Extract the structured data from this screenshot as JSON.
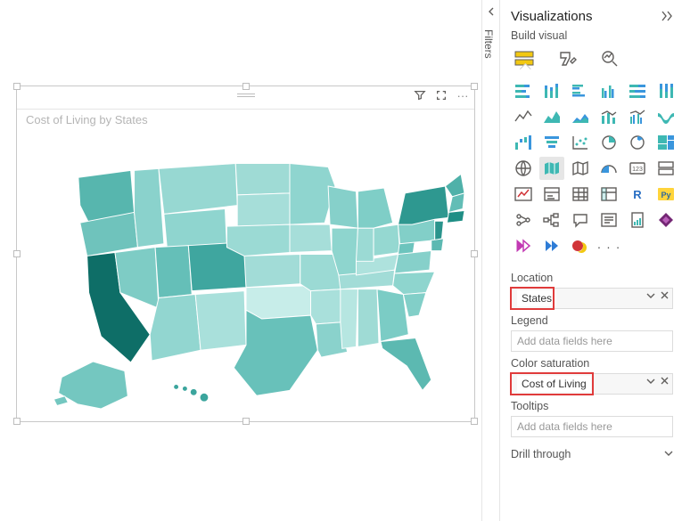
{
  "canvas": {
    "title": "Cost of Living by States"
  },
  "filters_rail": {
    "label": "Filters"
  },
  "panel": {
    "title": "Visualizations",
    "subtitle": "Build visual",
    "fields": {
      "location": {
        "label": "Location",
        "value": "States"
      },
      "legend": {
        "label": "Legend",
        "placeholder": "Add data fields here"
      },
      "saturation": {
        "label": "Color saturation",
        "value": "Cost of Living"
      },
      "tooltips": {
        "label": "Tooltips",
        "placeholder": "Add data fields here"
      },
      "drill": {
        "label": "Drill through"
      }
    },
    "visuals": {
      "r_label": "R",
      "py_label": "Py"
    },
    "more": "· · ·"
  }
}
